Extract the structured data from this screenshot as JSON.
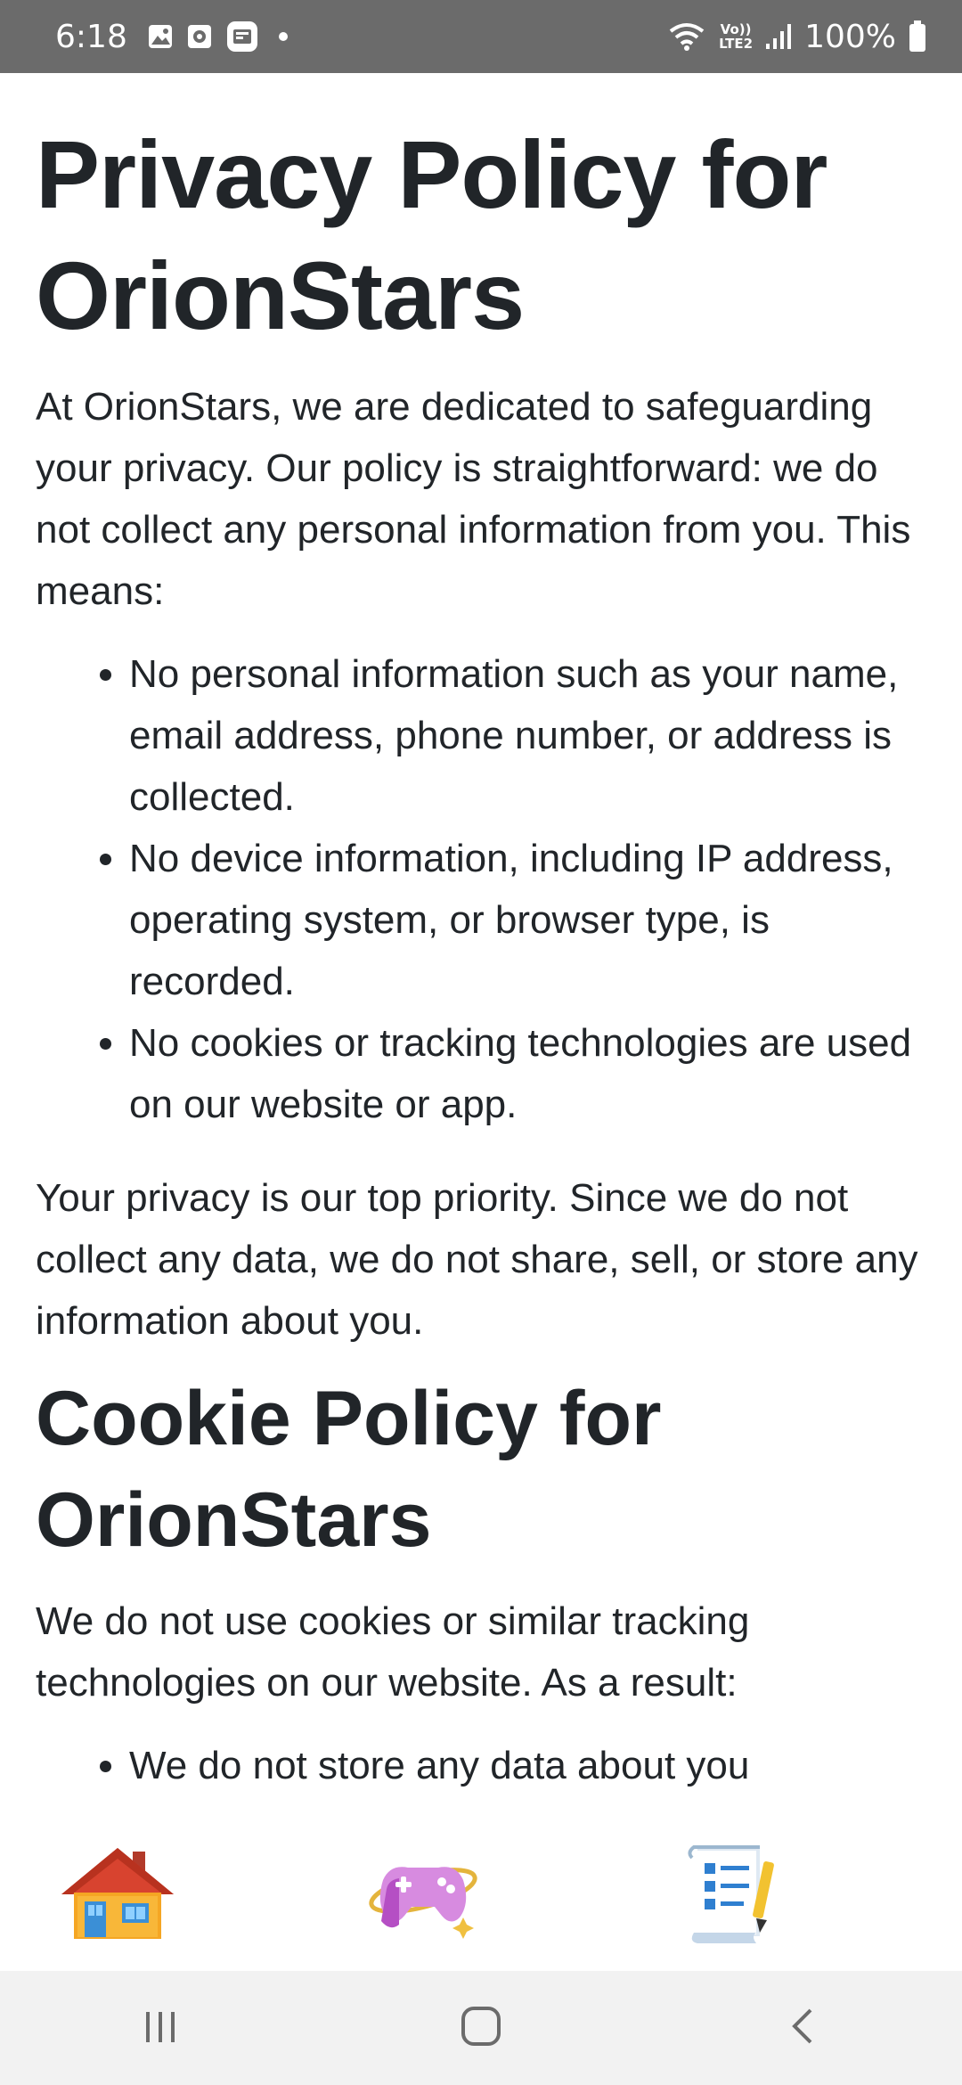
{
  "status_bar": {
    "time": "6:18",
    "battery": "100%",
    "network_top": "Vo))",
    "network_bottom": "LTE2"
  },
  "content": {
    "privacy_title": "Privacy Policy for OrionStars",
    "privacy_intro": "At OrionStars, we are dedicated to safeguarding your privacy. Our policy is straightforward: we do not collect any personal information from you. This means:",
    "privacy_items": [
      "No personal information such as your name, email address, phone number, or address is collected.",
      "No device information, including IP address, operating system, or browser type, is recorded.",
      "No cookies or tracking technologies are used on our website or app."
    ],
    "privacy_closing": "Your privacy is our top priority. Since we do not collect any data, we do not share, sell, or store any information about you.",
    "cookie_title": "Cookie Policy for OrionStars",
    "cookie_intro": "We do not use cookies or similar tracking technologies on our website. As a result:",
    "cookie_items": [
      "We do not store any data about you"
    ]
  },
  "tab_bar": {
    "items": [
      {
        "icon": "house-icon"
      },
      {
        "icon": "game-controller-icon"
      },
      {
        "icon": "checklist-icon"
      }
    ]
  },
  "nav_bar": {
    "items": [
      {
        "icon": "recent-apps-icon"
      },
      {
        "icon": "home-icon"
      },
      {
        "icon": "back-icon"
      }
    ]
  },
  "colors": {
    "status_bar_bg": "#6b6b6b",
    "text": "#212529",
    "nav_bar_bg": "#f2f2f2"
  }
}
